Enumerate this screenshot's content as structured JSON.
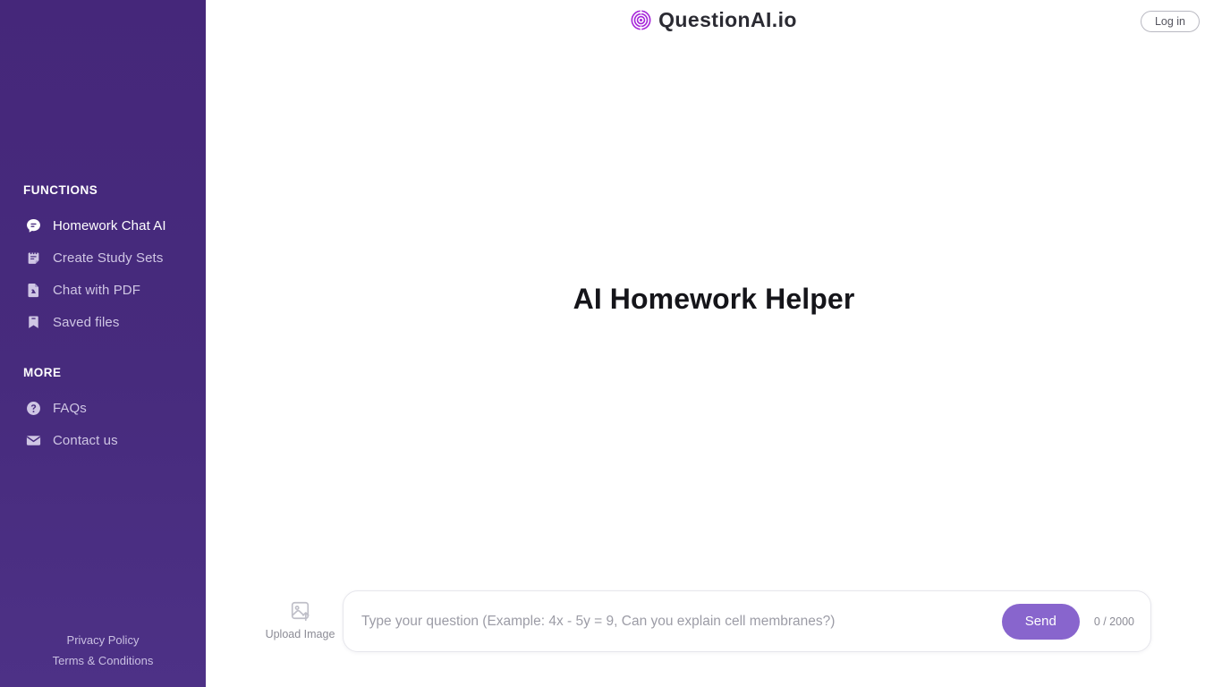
{
  "brand": {
    "name": "QuestionAI.io",
    "logo_icon": "spiral-target-icon",
    "accent_color": "#A626D9"
  },
  "topbar": {
    "login_label": "Log in"
  },
  "sidebar": {
    "background_color": "#472B7D",
    "sections": [
      {
        "heading": "FUNCTIONS",
        "items": [
          {
            "label": "Homework Chat AI",
            "icon": "chat-bubble-icon",
            "active": true
          },
          {
            "label": "Create Study Sets",
            "icon": "study-notes-icon",
            "active": false
          },
          {
            "label": "Chat with PDF",
            "icon": "pdf-file-icon",
            "active": false
          },
          {
            "label": "Saved files",
            "icon": "bookmark-icon",
            "active": false
          }
        ]
      },
      {
        "heading": "MORE",
        "items": [
          {
            "label": "FAQs",
            "icon": "question-circle-icon",
            "active": false
          },
          {
            "label": "Contact us",
            "icon": "envelope-icon",
            "active": false
          }
        ]
      }
    ],
    "footer_links": [
      {
        "label": "Privacy Policy"
      },
      {
        "label": "Terms & Conditions"
      }
    ]
  },
  "main": {
    "hero_title": "AI Homework Helper"
  },
  "composer": {
    "upload_label": "Upload Image",
    "upload_icon": "image-upload-icon",
    "input_value": "",
    "input_placeholder": "Type your question (Example: 4x - 5y = 9, Can you explain cell membranes?)",
    "send_label": "Send",
    "send_color": "#8865CD",
    "counter": "0 / 2000"
  }
}
